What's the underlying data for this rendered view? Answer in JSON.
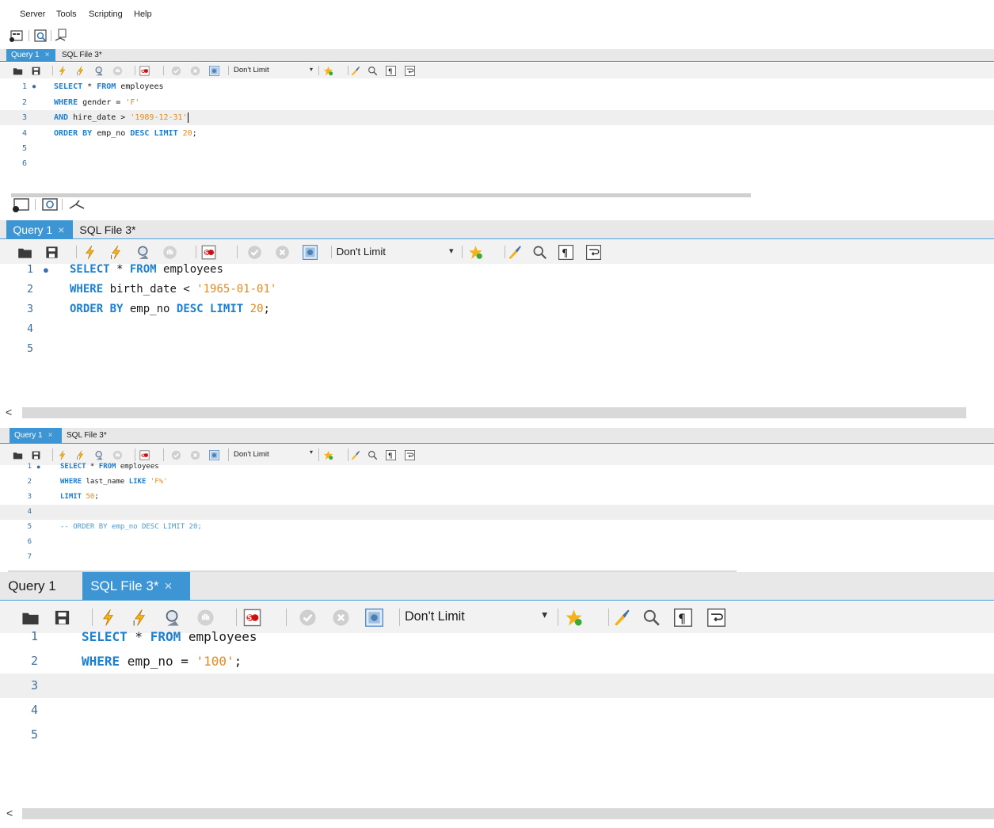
{
  "menu": [
    "Server",
    "Tools",
    "Scripting",
    "Help"
  ],
  "toolbar_icons": [
    "new-tab-icon",
    "inspector-icon",
    "explain-icon"
  ],
  "editor_toolbar": {
    "icons": [
      "open-folder-icon",
      "save-icon",
      "execute-lightning-icon",
      "execute-current-icon",
      "explain-magnifier-icon",
      "stop-icon",
      "toggle-error-icon",
      "commit-icon",
      "rollback-icon",
      "autocommit-icon",
      "beautify-star-icon",
      "format-brush-icon",
      "find-icon",
      "invisible-chars-icon",
      "word-wrap-icon"
    ],
    "limit_label": "Don't Limit",
    "limit_display": "Don′t Limit"
  },
  "panels": [
    {
      "tabs": [
        {
          "label": "Query 1",
          "active": true
        },
        {
          "label": "SQL File 3*",
          "active": false
        }
      ],
      "lines": [
        {
          "n": "1",
          "exec": true,
          "text": "SELECT * FROM employees"
        },
        {
          "n": "2",
          "text": "WHERE gender = 'F'"
        },
        {
          "n": "3",
          "text": "AND hire_date > '1989-12-31'",
          "current": true
        },
        {
          "n": "4",
          "text": "ORDER BY emp_no DESC LIMIT 20;"
        },
        {
          "n": "5",
          "text": ""
        },
        {
          "n": "6",
          "text": ""
        }
      ]
    },
    {
      "tabs": [
        {
          "label": "Query 1",
          "active": true
        },
        {
          "label": "SQL File 3*",
          "active": false
        }
      ],
      "lines": [
        {
          "n": "1",
          "exec": true,
          "text": "SELECT * FROM employees"
        },
        {
          "n": "2",
          "text": "WHERE birth_date < '1965-01-01'"
        },
        {
          "n": "3",
          "text": "ORDER BY emp_no DESC LIMIT 20;"
        },
        {
          "n": "4",
          "text": ""
        },
        {
          "n": "5",
          "text": ""
        }
      ],
      "scroll_arrow": "<"
    },
    {
      "tabs": [
        {
          "label": "Query 1",
          "active": true
        },
        {
          "label": "SQL File 3*",
          "active": false
        }
      ],
      "lines": [
        {
          "n": "1",
          "exec": true,
          "text": "SELECT * FROM employees"
        },
        {
          "n": "2",
          "text": "WHERE last_name LIKE 'F%'"
        },
        {
          "n": "3",
          "text": "LIMIT 50;"
        },
        {
          "n": "4",
          "text": "",
          "current": true
        },
        {
          "n": "5",
          "text": "-- ORDER BY emp_no DESC LIMIT 20;"
        },
        {
          "n": "6",
          "text": ""
        },
        {
          "n": "7",
          "text": ""
        }
      ]
    },
    {
      "tabs": [
        {
          "label": "Query 1",
          "active": false
        },
        {
          "label": "SQL File 3*",
          "active": true
        }
      ],
      "lines": [
        {
          "n": "1",
          "text": "SELECT * FROM employees"
        },
        {
          "n": "2",
          "text": "WHERE emp_no = '100';"
        },
        {
          "n": "3",
          "text": "",
          "current": true
        },
        {
          "n": "4",
          "text": ""
        },
        {
          "n": "5",
          "text": ""
        }
      ],
      "scroll_arrow": "<"
    }
  ],
  "colors": {
    "accent": "#3d95d4",
    "keyword": "#1b7fd3",
    "string": "#e38a1f",
    "linenum": "#3b6fa0"
  }
}
